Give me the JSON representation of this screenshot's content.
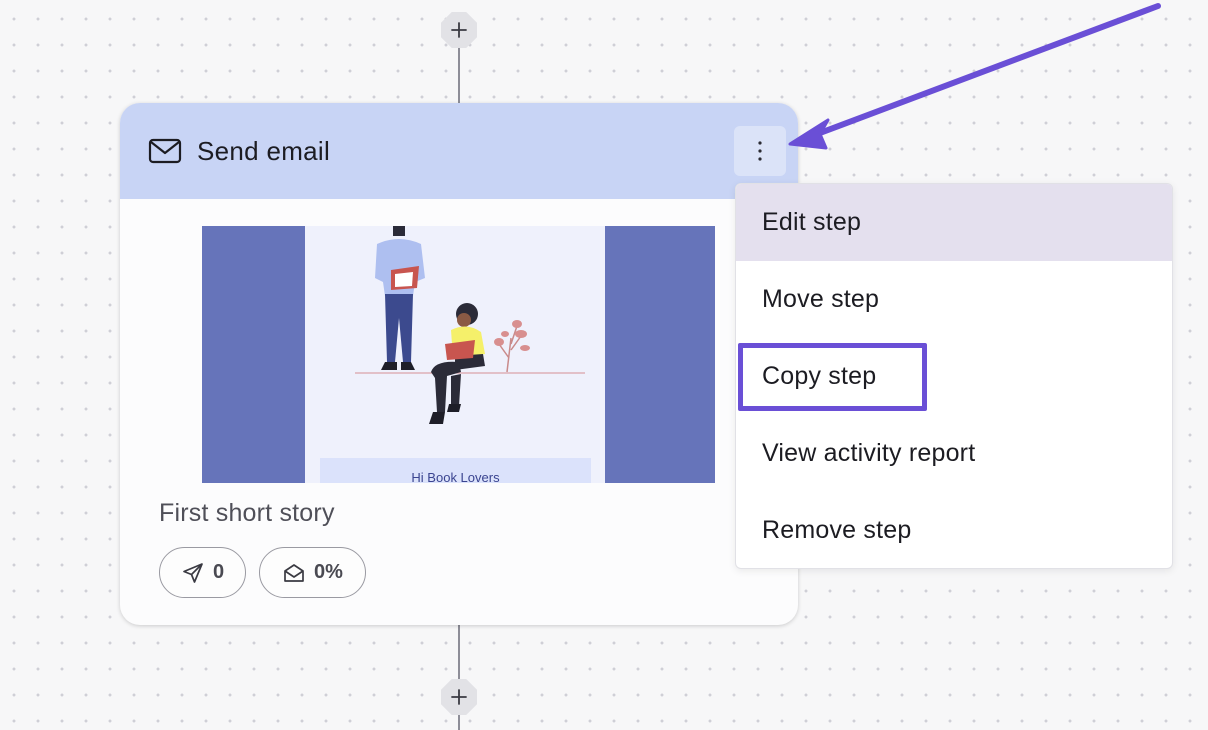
{
  "card": {
    "title": "Send email",
    "step_name": "First short story",
    "preview_banner": "Hi Book Lovers",
    "stats": {
      "sent": "0",
      "opened": "0%"
    }
  },
  "menu": {
    "items": [
      {
        "label": "Edit step",
        "state": "hovered"
      },
      {
        "label": "Move step"
      },
      {
        "label": "Copy step",
        "state": "highlighted"
      },
      {
        "label": "View activity report"
      },
      {
        "label": "Remove step"
      }
    ]
  },
  "icons": {
    "top_add": "plus-icon",
    "bottom_add": "plus-icon",
    "header": "envelope-icon",
    "options": "kebab-menu-icon",
    "sent_stat": "send-icon",
    "opened_stat": "open-envelope-icon"
  },
  "colors": {
    "header_bg": "#c8d4f5",
    "accent": "#6a4fd6",
    "preview_side": "#6674ba",
    "menu_hover": "#e4e0ee"
  }
}
